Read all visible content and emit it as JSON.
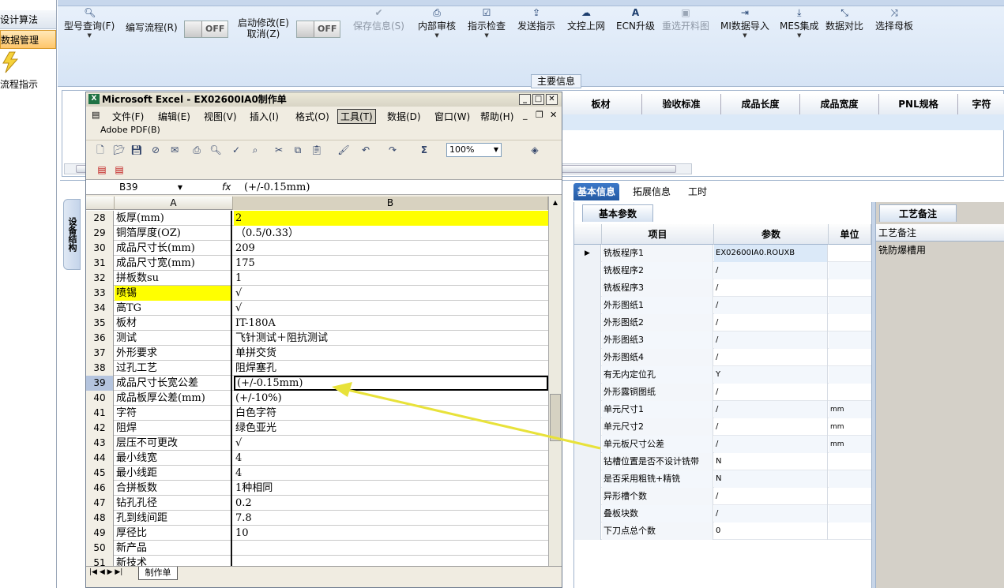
{
  "leftnav": {
    "items": [
      "设计算法",
      "数据管理",
      "流程指示"
    ]
  },
  "ribbon": {
    "buttons": [
      {
        "label": "型号查询(F)",
        "icon": "search-icon"
      },
      {
        "label": "编写流程(R)",
        "icon": "edit-icon"
      },
      {
        "label": "启动修改(E)\n取消(Z)",
        "icon": "edit-icon"
      },
      {
        "label": "保存信息(S)",
        "icon": "check-icon",
        "disabled": true
      },
      {
        "label": "内部审核",
        "icon": "print-icon"
      },
      {
        "label": "指示检查",
        "icon": "checkbox-icon"
      },
      {
        "label": "发送指示",
        "icon": "upload-icon"
      },
      {
        "label": "文控上网",
        "icon": "cloud-upload-icon"
      },
      {
        "label": "ECN升级",
        "icon": "font-a-icon"
      },
      {
        "label": "重选开料图",
        "icon": "image-icon",
        "disabled": true
      },
      {
        "label": "MI数据导入",
        "icon": "import-icon"
      },
      {
        "label": "MES集成",
        "icon": "download-icon"
      },
      {
        "label": "数据对比",
        "icon": "compress-icon"
      },
      {
        "label": "选择母板",
        "icon": "shuffle-icon"
      }
    ],
    "toggle_off": "OFF",
    "main_info": "主要信息"
  },
  "upper_grid": {
    "columns": [
      "板材",
      "验收标准",
      "成品长度",
      "成品宽度",
      "PNL规格",
      "字符"
    ]
  },
  "side_tab": "设备结构",
  "excel": {
    "title": "Microsoft Excel - EX02600IA0制作单",
    "menu": [
      "文件(F)",
      "编辑(E)",
      "视图(V)",
      "插入(I)",
      "格式(O)",
      "工具(T)",
      "数据(D)",
      "窗口(W)",
      "帮助(H)"
    ],
    "active_menu": "工具(T)",
    "pdf_menu": "Adobe PDF(B)",
    "zoom": "100%",
    "name_box": "B39",
    "fx": "fx",
    "formula_value": "(+/-0.15mm)",
    "columns": [
      "A",
      "B"
    ],
    "selected_row": "39",
    "rows": [
      {
        "n": "28",
        "a": "板厚(mm)",
        "b": "2",
        "hl_b": true
      },
      {
        "n": "29",
        "a": "铜箔厚度(OZ)",
        "b": "（0.5/0.33）"
      },
      {
        "n": "30",
        "a": "成品尺寸长(mm)",
        "b": "209"
      },
      {
        "n": "31",
        "a": "成品尺寸宽(mm)",
        "b": "175"
      },
      {
        "n": "32",
        "a": "拼板数su",
        "b": "1"
      },
      {
        "n": "33",
        "a": "喷锡",
        "b": "√",
        "hl_a": true
      },
      {
        "n": "34",
        "a": "高TG",
        "b": "√"
      },
      {
        "n": "35",
        "a": "板材",
        "b": "IT-180A"
      },
      {
        "n": "36",
        "a": "测试",
        "b": "飞针测试＋阻抗测试"
      },
      {
        "n": "37",
        "a": "外形要求",
        "b": "单拼交货"
      },
      {
        "n": "38",
        "a": "过孔工艺",
        "b": "阻焊塞孔"
      },
      {
        "n": "39",
        "a": "成品尺寸长宽公差",
        "b": "(+/-0.15mm)"
      },
      {
        "n": "40",
        "a": "成品板厚公差(mm)",
        "b": "(+/-10%)"
      },
      {
        "n": "41",
        "a": "字符",
        "b": "白色字符"
      },
      {
        "n": "42",
        "a": "阻焊",
        "b": "绿色亚光"
      },
      {
        "n": "43",
        "a": "层压不可更改",
        "b": "√"
      },
      {
        "n": "44",
        "a": "最小线宽",
        "b": "4"
      },
      {
        "n": "45",
        "a": "最小线距",
        "b": "4"
      },
      {
        "n": "46",
        "a": "合拼板数",
        "b": "1种相同"
      },
      {
        "n": "47",
        "a": "钻孔孔径",
        "b": "0.2"
      },
      {
        "n": "48",
        "a": "孔到线间距",
        "b": "7.8"
      },
      {
        "n": "49",
        "a": "厚径比",
        "b": "10"
      },
      {
        "n": "50",
        "a": "新产品",
        "b": ""
      },
      {
        "n": "51",
        "a": "新技术",
        "b": ""
      }
    ],
    "sheet_tab": "制作单"
  },
  "right_tabs": [
    "基本信息",
    "拓展信息",
    "工时"
  ],
  "params_panel": {
    "tab": "基本参数",
    "headers": [
      "项目",
      "参数",
      "单位"
    ],
    "rows": [
      {
        "name": "铣板程序1",
        "value": "EX02600IA0.ROUXB",
        "unit": "",
        "current": true
      },
      {
        "name": "铣板程序2",
        "value": "/",
        "unit": ""
      },
      {
        "name": "铣板程序3",
        "value": "/",
        "unit": ""
      },
      {
        "name": "外形图纸1",
        "value": "/",
        "unit": ""
      },
      {
        "name": "外形图纸2",
        "value": "/",
        "unit": ""
      },
      {
        "name": "外形图纸3",
        "value": "/",
        "unit": ""
      },
      {
        "name": "外形图纸4",
        "value": "/",
        "unit": ""
      },
      {
        "name": "有无内定位孔",
        "value": "Y",
        "unit": ""
      },
      {
        "name": "外形露铜图纸",
        "value": "/",
        "unit": ""
      },
      {
        "name": "单元尺寸1",
        "value": "/",
        "unit": "mm"
      },
      {
        "name": "单元尺寸2",
        "value": "/",
        "unit": "mm"
      },
      {
        "name": "单元板尺寸公差",
        "value": "/",
        "unit": "mm"
      },
      {
        "name": "钻槽位置是否不设计铣带",
        "value": "N",
        "unit": ""
      },
      {
        "name": "是否采用粗铣+精铣",
        "value": "N",
        "unit": ""
      },
      {
        "name": "异形槽个数",
        "value": "/",
        "unit": ""
      },
      {
        "name": "叠板块数",
        "value": "/",
        "unit": ""
      },
      {
        "name": "下刀点总个数",
        "value": "0",
        "unit": ""
      }
    ]
  },
  "craft_panel": {
    "tab": "工艺备注",
    "header": "工艺备注",
    "text": "铣防爆槽用"
  },
  "colors": {
    "highlight": "#ffff00",
    "accent": "#245aa3",
    "arrow": "#e8e23a"
  }
}
